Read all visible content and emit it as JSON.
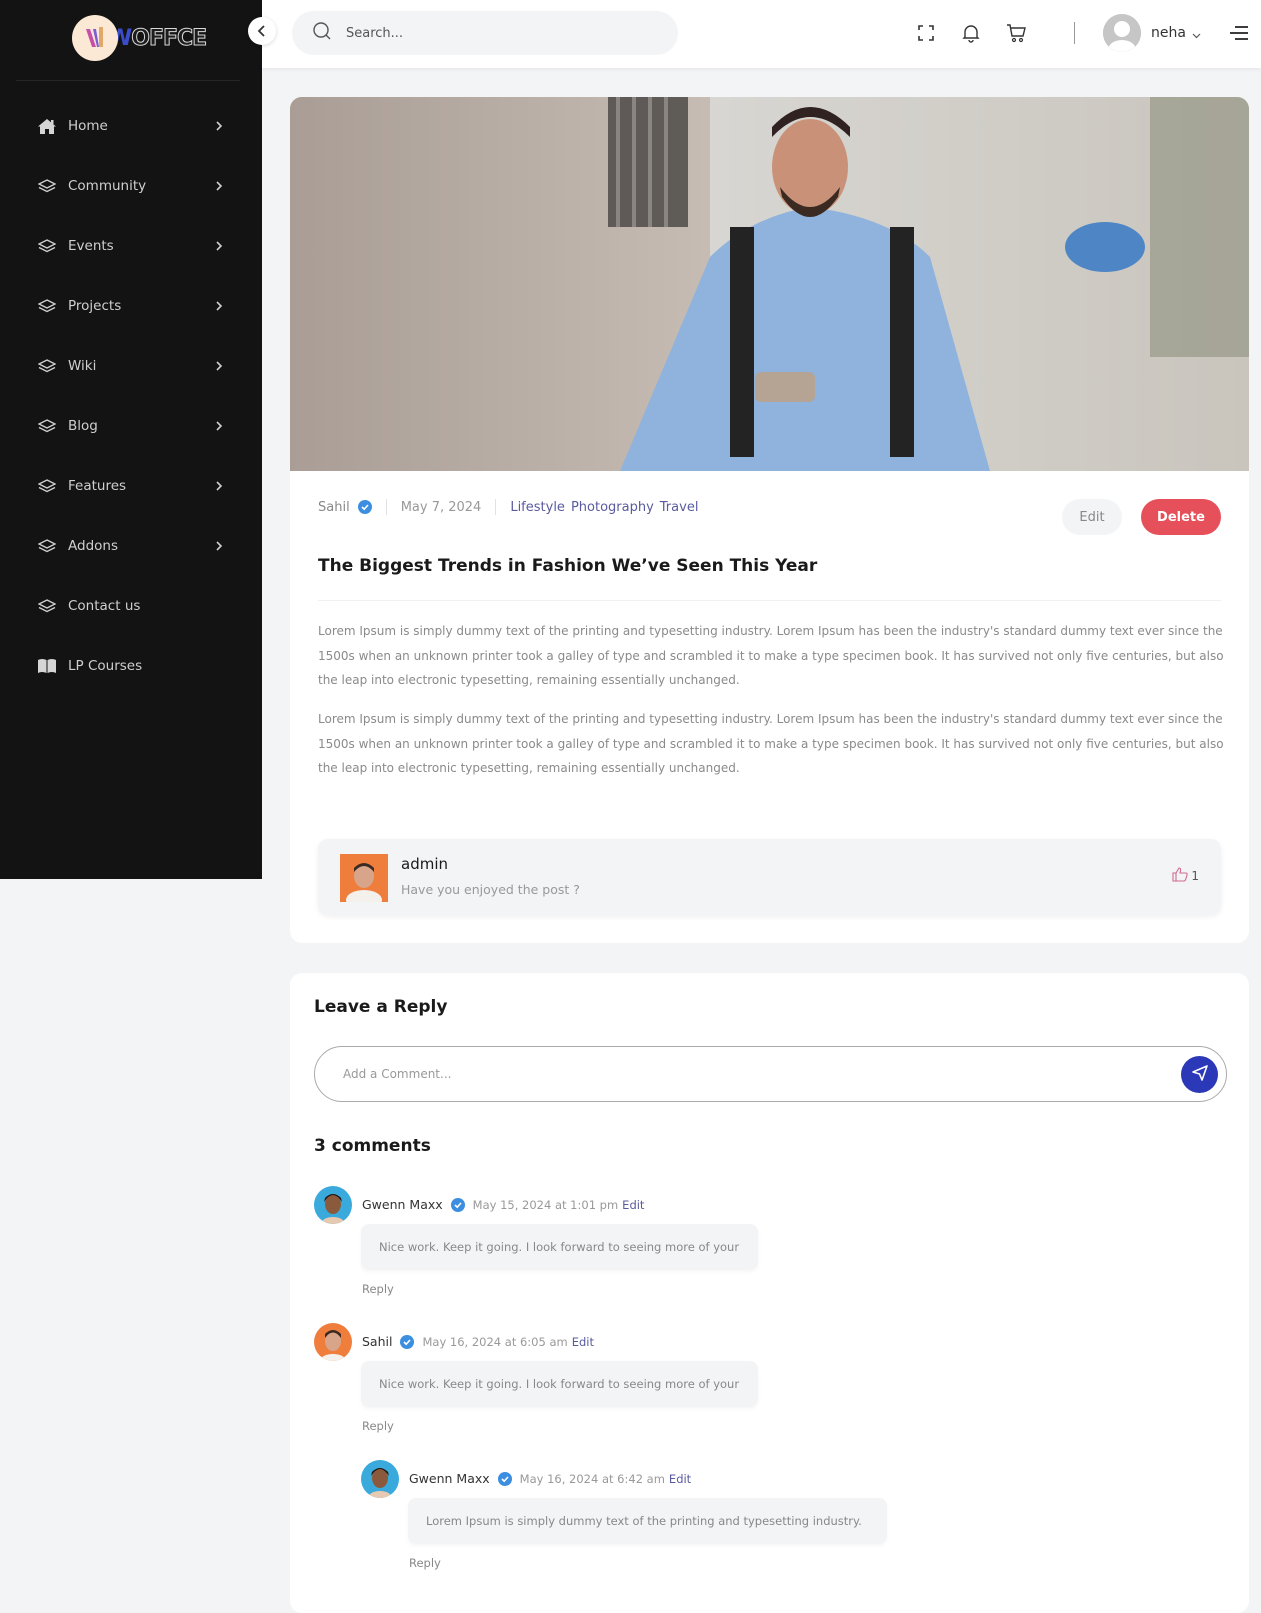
{
  "app": {
    "logo_text_prefix": "W",
    "logo_text_rest": "OFFCE"
  },
  "sidebar": {
    "items": [
      {
        "label": "Home",
        "icon": "home-icon",
        "has_chevron": true
      },
      {
        "label": "Community",
        "icon": "layers-icon",
        "has_chevron": true
      },
      {
        "label": "Events",
        "icon": "layers-icon",
        "has_chevron": true
      },
      {
        "label": "Projects",
        "icon": "layers-icon",
        "has_chevron": true
      },
      {
        "label": "Wiki",
        "icon": "layers-icon",
        "has_chevron": true
      },
      {
        "label": "Blog",
        "icon": "layers-icon",
        "has_chevron": true
      },
      {
        "label": "Features",
        "icon": "layers-icon",
        "has_chevron": true
      },
      {
        "label": "Addons",
        "icon": "layers-icon",
        "has_chevron": true
      },
      {
        "label": "Contact us",
        "icon": "layers-icon",
        "has_chevron": false
      },
      {
        "label": "LP Courses",
        "icon": "book-icon",
        "has_chevron": false
      }
    ]
  },
  "header": {
    "search_placeholder": "Search...",
    "icons": [
      "fullscreen-icon",
      "bell-icon",
      "cart-icon"
    ],
    "user_name": "neha"
  },
  "post": {
    "author": "Sahil",
    "date": "May 7, 2024",
    "tags": [
      "Lifestyle",
      "Photography",
      "Travel"
    ],
    "edit_label": "Edit",
    "delete_label": "Delete",
    "title": "The Biggest Trends in Fashion We’ve Seen This Year",
    "paragraphs": [
      "Lorem Ipsum is simply dummy text of the printing and typesetting industry. Lorem Ipsum has been the industry's standard dummy text ever since the 1500s  when an unknown printer took a galley of type and scrambled it to make a type specimen book. It has survived not only five centuries, but also the leap into  electronic typesetting, remaining essentially unchanged.",
      "Lorem Ipsum is simply dummy text of the printing and typesetting industry. Lorem Ipsum has been the industry's standard dummy text ever since the 1500s  when an unknown printer took a galley of type and scrambled it to make a type specimen book. It has survived not only five centuries, but also the leap into  electronic typesetting, remaining essentially unchanged."
    ],
    "admin_box": {
      "name": "admin",
      "question": "Have you enjoyed the post ?",
      "likes": "1"
    }
  },
  "reply": {
    "title": "Leave a Reply",
    "input_placeholder": "Add a Comment...",
    "comments_count_label": "3 comments",
    "comments": [
      {
        "name": "Gwenn Maxx",
        "date": "May 15, 2024 at 1:01 pm",
        "edit": "Edit",
        "text": "Nice work. Keep it going. I look forward to seeing more of your",
        "reply": "Reply",
        "avatar": "woman"
      },
      {
        "name": "Sahil",
        "date": "May 16, 2024 at 6:05 am",
        "edit": "Edit",
        "text": "Nice work. Keep it going. I look forward to seeing more of your",
        "reply": "Reply",
        "avatar": "man"
      },
      {
        "name": "Gwenn Maxx",
        "date": "May 16, 2024 at 6:42 am",
        "edit": "Edit",
        "text": "Lorem Ipsum is simply dummy text of the  printing and typesetting industry.",
        "reply": "Reply",
        "avatar": "woman",
        "nested": true
      }
    ]
  },
  "colors": {
    "sidebar_bg": "#131313",
    "accent": "#2b39b8",
    "delete": "#e6505a",
    "tag": "#5a5b9e",
    "verified": "#3b8ee0"
  }
}
